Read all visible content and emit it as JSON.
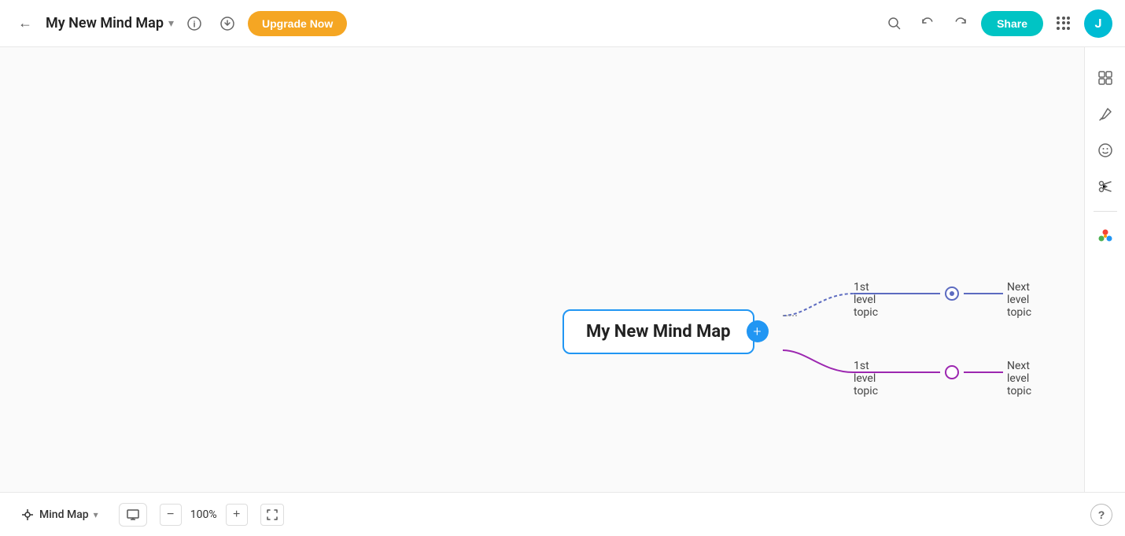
{
  "header": {
    "back_label": "←",
    "title": "My New Mind Map",
    "chevron": "▾",
    "info_icon": "ℹ",
    "download_icon": "↓",
    "upgrade_label": "Upgrade Now",
    "search_icon": "🔍",
    "undo_icon": "↩",
    "redo_icon": "↪",
    "share_label": "Share",
    "apps_icon": "⋮⋮⋮",
    "avatar_label": "J"
  },
  "canvas": {
    "central_node": "My New Mind Map",
    "add_icon": "+",
    "topics": [
      {
        "id": "topic1",
        "first_label": "1st level topic",
        "node_color": "#5C6BC0",
        "next_label": "Next level topic"
      },
      {
        "id": "topic2",
        "first_label": "1st level topic",
        "node_color": "#9C27B0",
        "next_label": "Next level topic"
      }
    ],
    "dots_icon": "···"
  },
  "right_toolbar": {
    "layout_icon": "⊞",
    "brush_icon": "🖌",
    "emoji_icon": "☺",
    "scissors_icon": "✂",
    "logo_icon": "✿"
  },
  "bottom_toolbar": {
    "mode_icon": "✂",
    "mode_label": "Mind Map",
    "mode_chevron": "▾",
    "present_icon": "▶",
    "zoom_minus": "−",
    "zoom_value": "100%",
    "zoom_plus": "+",
    "fit_icon": "⤢",
    "help_icon": "?"
  }
}
